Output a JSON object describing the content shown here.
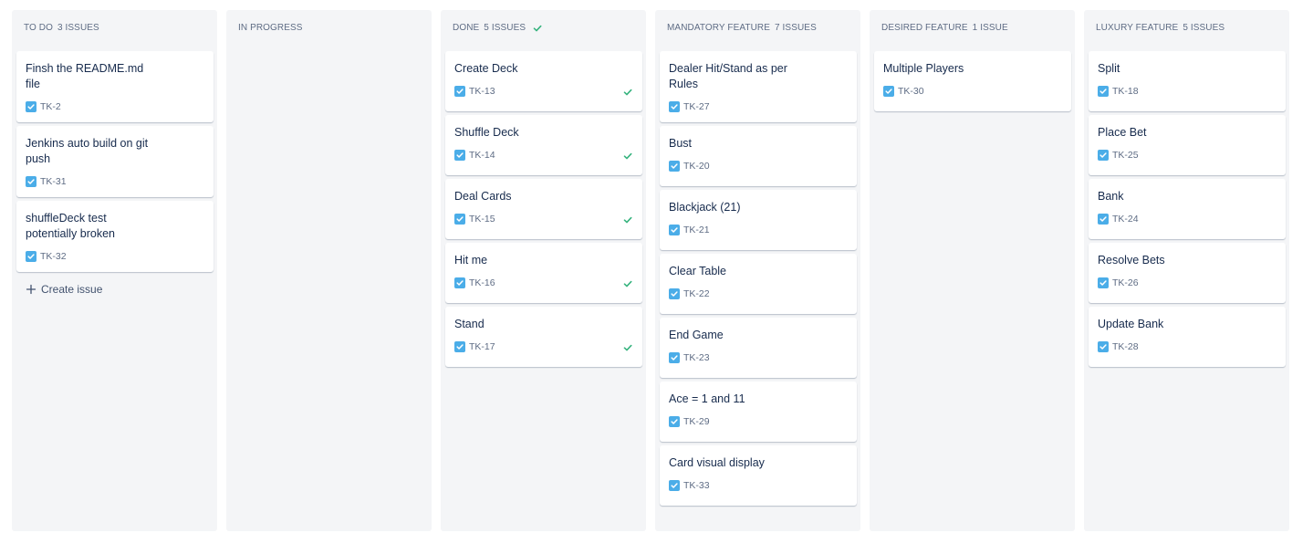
{
  "columns": [
    {
      "name": "TO DO",
      "count": "3 ISSUES",
      "done": false,
      "cards": [
        {
          "title": "Finsh the README.md file",
          "key": "TK-2",
          "done": false
        },
        {
          "title": "Jenkins auto build on git push",
          "key": "TK-31",
          "done": false
        },
        {
          "title": "shuffleDeck test potentially broken",
          "key": "TK-32",
          "done": false
        }
      ],
      "create_label": "Create issue"
    },
    {
      "name": "IN PROGRESS",
      "count": "",
      "done": false,
      "cards": []
    },
    {
      "name": "DONE",
      "count": "5 ISSUES",
      "done": true,
      "cards": [
        {
          "title": "Create Deck",
          "key": "TK-13",
          "done": true
        },
        {
          "title": "Shuffle Deck",
          "key": "TK-14",
          "done": true
        },
        {
          "title": "Deal Cards",
          "key": "TK-15",
          "done": true
        },
        {
          "title": "Hit me",
          "key": "TK-16",
          "done": true
        },
        {
          "title": "Stand",
          "key": "TK-17",
          "done": true
        }
      ]
    },
    {
      "name": "MANDATORY FEATURE",
      "count": "7 ISSUES",
      "done": false,
      "cards": [
        {
          "title": "Dealer Hit/Stand as per Rules",
          "key": "TK-27",
          "done": false
        },
        {
          "title": "Bust",
          "key": "TK-20",
          "done": false
        },
        {
          "title": "Blackjack (21)",
          "key": "TK-21",
          "done": false
        },
        {
          "title": "Clear Table",
          "key": "TK-22",
          "done": false
        },
        {
          "title": "End Game",
          "key": "TK-23",
          "done": false
        },
        {
          "title": "Ace = 1 and 11",
          "key": "TK-29",
          "done": false
        },
        {
          "title": "Card visual display",
          "key": "TK-33",
          "done": false
        }
      ]
    },
    {
      "name": "DESIRED FEATURE",
      "count": "1 ISSUE",
      "done": false,
      "cards": [
        {
          "title": "Multiple Players",
          "key": "TK-30",
          "done": false
        }
      ]
    },
    {
      "name": "LUXURY FEATURE",
      "count": "5 ISSUES",
      "done": false,
      "cards": [
        {
          "title": "Split",
          "key": "TK-18",
          "done": false
        },
        {
          "title": "Place Bet",
          "key": "TK-25",
          "done": false
        },
        {
          "title": "Bank",
          "key": "TK-24",
          "done": false
        },
        {
          "title": "Resolve Bets",
          "key": "TK-26",
          "done": false
        },
        {
          "title": "Update Bank",
          "key": "TK-28",
          "done": false
        }
      ]
    }
  ],
  "icons": {
    "issue_type": "task-checkbox-icon",
    "done": "checkmark-icon",
    "create": "plus-icon"
  },
  "colors": {
    "column_bg": "#f4f5f7",
    "task_icon": "#4bade8",
    "done_green": "#36b37e",
    "header_text": "#5e6c84"
  }
}
